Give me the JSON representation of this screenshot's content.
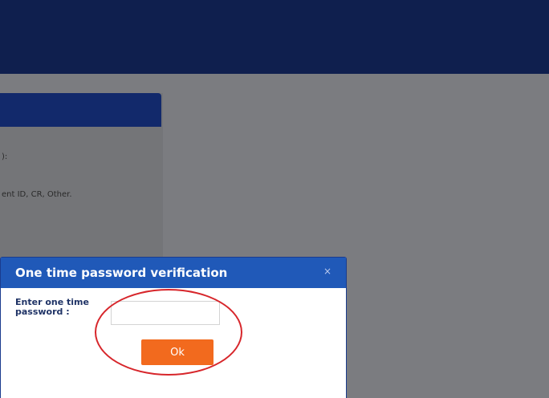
{
  "background_panel": {
    "line_1": "):",
    "line_2": "ent ID, CR, Other."
  },
  "modal": {
    "title": "One time password verification",
    "close_glyph": "×",
    "otp_label": "Enter one time password :",
    "otp_value": "",
    "ok_label": "Ok"
  },
  "colors": {
    "topbar": "#0f1f4e",
    "modal_header": "#2059b8",
    "ok_button": "#f26a1e",
    "highlight": "#d7262b"
  }
}
